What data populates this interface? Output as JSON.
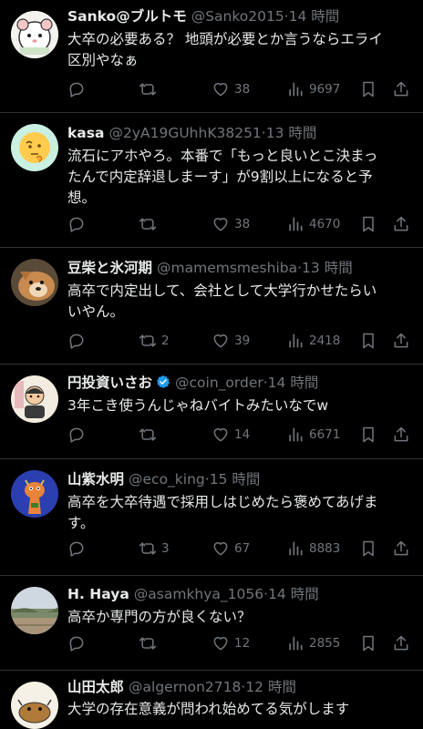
{
  "tweets": [
    {
      "name": "Sanko@ブルトモ",
      "handle": "@Sanko2015",
      "sep": "·",
      "time": "14 時間",
      "verified": false,
      "lines": [
        "大卒の必要ある？ 地頭が必要とか言うならエライ",
        "区別やなぁ"
      ],
      "replies": "",
      "retweets": "",
      "likes": "38",
      "views": "9697",
      "avatar": "hamster-illustration"
    },
    {
      "name": "kasa",
      "handle": "@2yA19GUhhK38251",
      "sep": "·",
      "time": "13 時間",
      "verified": false,
      "lines": [
        "流石にアホやろ。本番で「もっと良いとこ決まっ",
        "たんで内定辞退しまーす」が9割以上になると予",
        "想。"
      ],
      "replies": "",
      "retweets": "",
      "likes": "38",
      "views": "4670",
      "avatar": "thinking-emoji"
    },
    {
      "name": "豆柴と氷河期",
      "handle": "@mamemsmeshiba",
      "sep": "·",
      "time": "13 時間",
      "verified": false,
      "lines": [
        "高卒で内定出して、会社として大学行かせたらい",
        "いやん。"
      ],
      "replies": "",
      "retweets": "2",
      "likes": "39",
      "views": "2418",
      "avatar": "shiba-dog-photo"
    },
    {
      "name": "円投資いさお",
      "handle": "@coin_order",
      "sep": "·",
      "time": "14 時間",
      "verified": true,
      "lines": [
        "3年こき使うんじゃねバイトみたいなでw"
      ],
      "replies": "",
      "retweets": "",
      "likes": "14",
      "views": "6671",
      "avatar": "cartoon-man"
    },
    {
      "name": "山紫水明",
      "handle": "@eco_king",
      "sep": "·",
      "time": "15 時間",
      "verified": false,
      "lines": [
        "高卒を大卒待遇で採用しはじめたら褒めてあげま",
        "す。"
      ],
      "replies": "",
      "retweets": "3",
      "likes": "67",
      "views": "8883",
      "avatar": "giraffe-toy"
    },
    {
      "name": "H. Haya",
      "handle": "@asamkhya_1056",
      "sep": "·",
      "time": "14 時間",
      "verified": false,
      "lines": [
        "高卒か専門の方が良くない？"
      ],
      "replies": "",
      "retweets": "",
      "likes": "12",
      "views": "2855",
      "avatar": "landscape-photo"
    },
    {
      "name": "山田太郎",
      "handle": "@algernon2718",
      "sep": "·",
      "time": "12 時間",
      "verified": false,
      "lines": [
        "大学の存在意義が問われ始めてる気がします"
      ],
      "replies": "",
      "retweets": "",
      "likes": "",
      "views": "",
      "avatar": "cartoon-animal"
    }
  ],
  "colors": {
    "background": "#000000",
    "text": "#e7e9ea",
    "muted": "#71767b",
    "divider": "#2f3336",
    "verified": "#1d9bf0"
  },
  "icons": [
    "reply-icon",
    "retweet-icon",
    "like-icon",
    "views-icon",
    "bookmark-icon",
    "share-icon"
  ]
}
